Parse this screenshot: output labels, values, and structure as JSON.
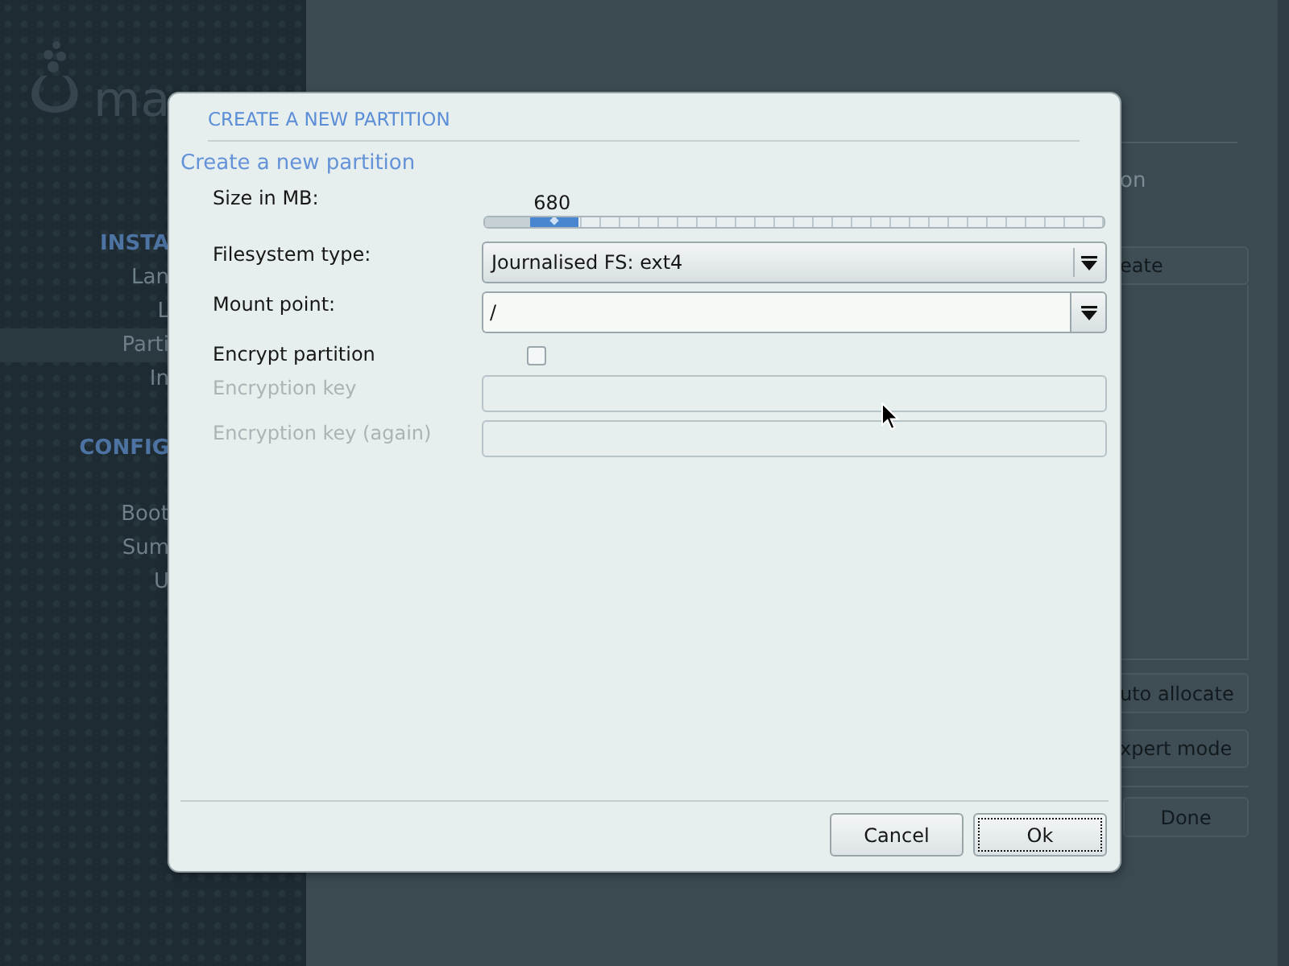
{
  "sidebar": {
    "logo_text": "ma",
    "sections": [
      {
        "heading": "INSTA",
        "items": [
          {
            "label": "Lan",
            "selected": false
          },
          {
            "label": "L",
            "selected": false
          },
          {
            "label": "Parti",
            "selected": true
          },
          {
            "label": "In",
            "selected": false
          }
        ]
      },
      {
        "heading": "CONFIG",
        "items": [
          {
            "label": "Boot",
            "selected": false
          },
          {
            "label": "Sum",
            "selected": false
          },
          {
            "label": "U",
            "selected": false
          }
        ]
      }
    ]
  },
  "main_panel": {
    "title": "on",
    "create_button": "eate",
    "buttons": [
      "uto allocate",
      "xpert mode"
    ],
    "done_button": "Done"
  },
  "dialog": {
    "title": "CREATE A NEW PARTITION",
    "heading": "Create a new partition",
    "fields": [
      {
        "kind": "slider",
        "label": "Size in MB:",
        "value": "680",
        "level": 0.08,
        "disabled": false
      },
      {
        "kind": "combo",
        "label": "Filesystem type:",
        "value": "Journalised FS: ext4",
        "disabled": false
      },
      {
        "kind": "editable_combo",
        "label": "Mount point:",
        "value": "/",
        "disabled": false
      },
      {
        "kind": "checkbox",
        "label": "Encrypt partition",
        "checked": false,
        "disabled": false
      },
      {
        "kind": "entry",
        "label": "Encryption key",
        "disabled": true
      },
      {
        "kind": "entry",
        "label": "Encryption key (again)",
        "disabled": true
      }
    ],
    "buttons": [
      {
        "label": "Cancel",
        "focused": false
      },
      {
        "label": "Ok",
        "focused": true
      }
    ]
  }
}
